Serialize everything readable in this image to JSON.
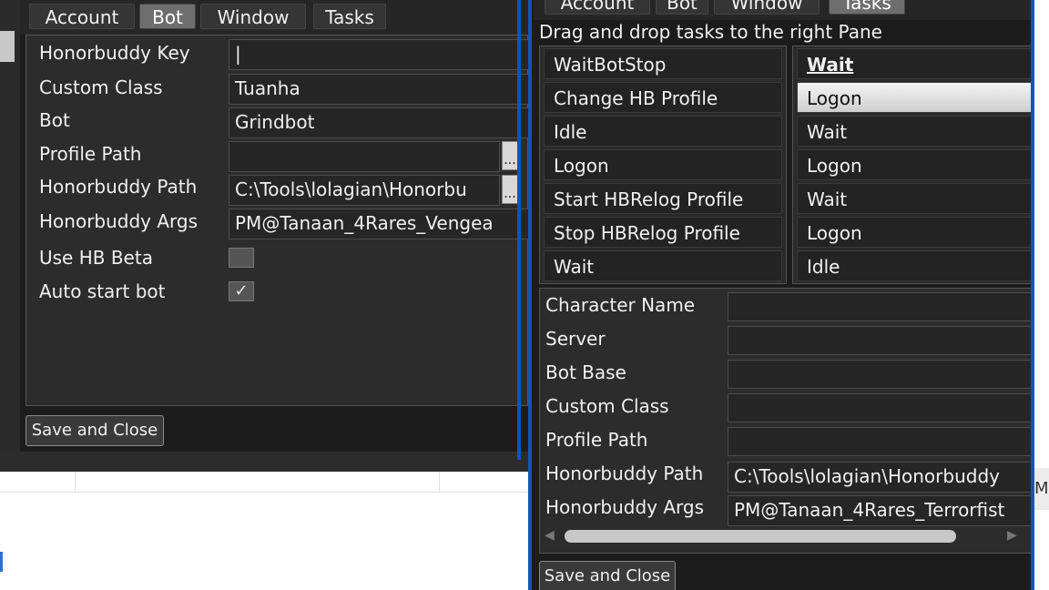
{
  "left": {
    "tabs": [
      "Account",
      "Bot",
      "Window",
      "Tasks"
    ],
    "active_tab": "Bot",
    "fields": [
      {
        "label": "Honorbuddy Key",
        "value": "|"
      },
      {
        "label": "Custom Class",
        "value": "Tuanha"
      },
      {
        "label": "Bot",
        "value": "Grindbot"
      },
      {
        "label": "Profile Path",
        "value": ""
      },
      {
        "label": "Honorbuddy Path",
        "value": "C:\\Tools\\lolagian\\Honorbu"
      },
      {
        "label": "Honorbuddy Args",
        "value": "PM@Tanaan_4Rares_Vengea"
      }
    ],
    "checkboxes": [
      {
        "label": "Use HB Beta",
        "checked": false
      },
      {
        "label": "Auto start bot",
        "checked": true,
        "mark": "✓"
      }
    ],
    "browse_label": "...",
    "save_button": "Save and Close"
  },
  "right": {
    "tabs": [
      "Account",
      "Bot",
      "Window",
      "Tasks"
    ],
    "active_tab": "Tasks",
    "hint": "Drag and drop tasks to the right Pane",
    "available_tasks": [
      "WaitBotStop",
      "Change HB Profile",
      "Idle",
      "Logon",
      "Start HBRelog Profile",
      "Stop HBRelog Profile",
      "Wait"
    ],
    "queued_tasks": [
      "Wait",
      "Logon",
      "Wait",
      "Logon",
      "Wait",
      "Logon",
      "Idle"
    ],
    "details": [
      {
        "label": "Character Name",
        "value": ""
      },
      {
        "label": "Server",
        "value": ""
      },
      {
        "label": "Bot Base",
        "value": ""
      },
      {
        "label": "Custom Class",
        "value": ""
      },
      {
        "label": "Profile Path",
        "value": ""
      },
      {
        "label": "Honorbuddy Path",
        "value": "C:\\Tools\\lolagian\\Honorbuddy"
      },
      {
        "label": "Honorbuddy Args",
        "value": "PM@Tanaan_4Rares_Terrorfist"
      }
    ],
    "save_button": "Save and Close"
  },
  "far_right_clip": "M",
  "colors": {
    "accent_blue": "#0a57b8",
    "window_bg": "#1c1c1c",
    "panel_bg": "#2c2c2c"
  }
}
